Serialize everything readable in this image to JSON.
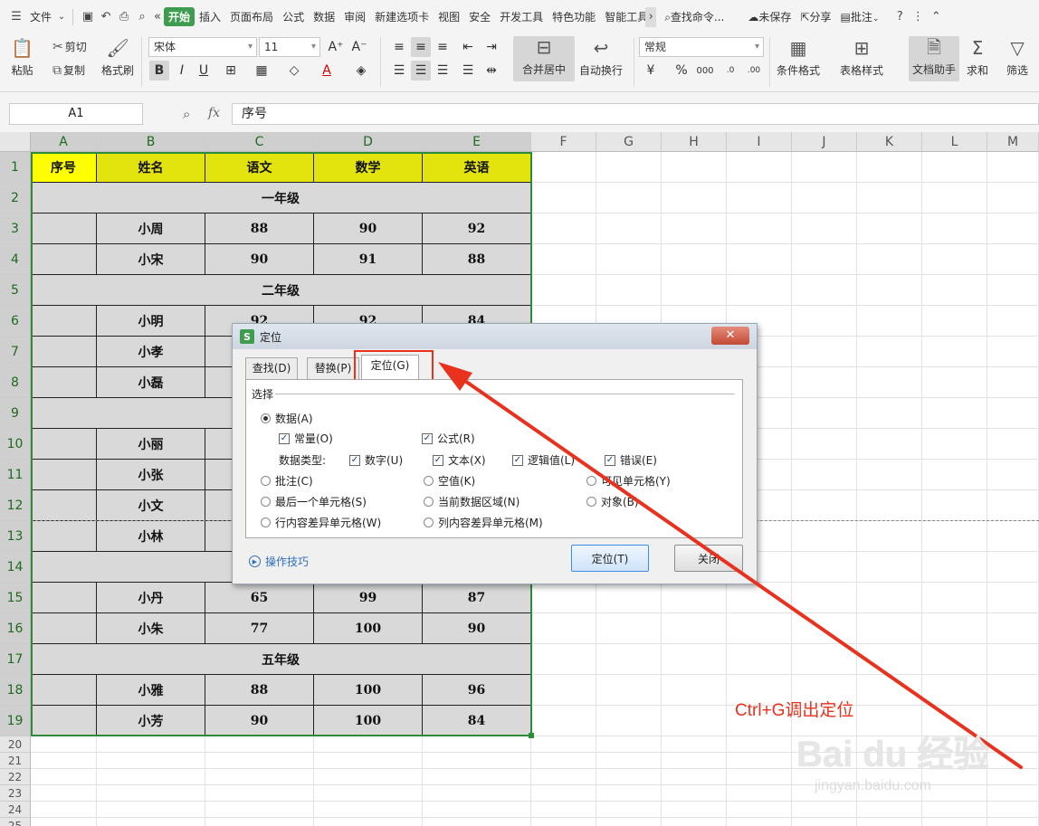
{
  "menubar": {
    "file": "文件",
    "tabs": [
      "开始",
      "插入",
      "页面布局",
      "公式",
      "数据",
      "审阅",
      "新建选项卡",
      "视图",
      "安全",
      "开发工具",
      "特色功能",
      "智能工具"
    ],
    "active_tab": "开始",
    "search": "查找命令...",
    "unsaved": "未保存",
    "share": "分享",
    "comment": "批注"
  },
  "ribbon": {
    "paste": "粘贴",
    "cut": "剪切",
    "copy": "复制",
    "format_painter": "格式刷",
    "font_name": "宋体",
    "font_size": "11",
    "merge_center": "合并居中",
    "wrap_text": "自动换行",
    "number_format": "常规",
    "conditional_format": "条件格式",
    "table_style": "表格样式",
    "doc_assistant": "文档助手",
    "sum": "求和",
    "filter": "筛选"
  },
  "formula_bar": {
    "cell_ref": "A1",
    "fx": "fx",
    "content": "序号"
  },
  "columns": [
    "A",
    "B",
    "C",
    "D",
    "E",
    "F",
    "G",
    "H",
    "I",
    "J",
    "K",
    "L",
    "M"
  ],
  "rows": [
    "1",
    "2",
    "3",
    "4",
    "5",
    "6",
    "7",
    "8",
    "9",
    "10",
    "11",
    "12",
    "13",
    "14",
    "15",
    "16",
    "17",
    "18",
    "19",
    "20",
    "21",
    "22",
    "23",
    "24",
    "25"
  ],
  "table": {
    "headers": [
      "序号",
      "姓名",
      "语文",
      "数学",
      "英语"
    ],
    "r2": "一年级",
    "r3": [
      "小周",
      "88",
      "90",
      "92"
    ],
    "r4": [
      "小宋",
      "90",
      "91",
      "88"
    ],
    "r5": "二年级",
    "r6": [
      "小明",
      "92",
      "92",
      "84"
    ],
    "r7": "小孝",
    "r8": "小磊",
    "r10": "小丽",
    "r11": "小张",
    "r12": "小文",
    "r13": "小林",
    "r15": [
      "小丹",
      "65",
      "99",
      "87"
    ],
    "r16": [
      "小朱",
      "77",
      "100",
      "90"
    ],
    "r17": "五年级",
    "r18": [
      "小雅",
      "88",
      "100",
      "96"
    ],
    "r19": [
      "小芳",
      "90",
      "100",
      "84"
    ]
  },
  "dialog": {
    "title": "定位",
    "tabs": [
      "查找(D)",
      "替换(P)",
      "定位(G)"
    ],
    "group": "选择",
    "data": "数据(A)",
    "constant": "常量(O)",
    "formula": "公式(R)",
    "data_type": "数据类型:",
    "number": "数字(U)",
    "text": "文本(X)",
    "logical": "逻辑值(L)",
    "error": "错误(E)",
    "comments": "批注(C)",
    "blanks": "空值(K)",
    "visible": "可见单元格(Y)",
    "last_cell": "最后一个单元格(S)",
    "current_region": "当前数据区域(N)",
    "objects": "对象(B)",
    "row_diff": "行内容差异单元格(W)",
    "col_diff": "列内容差异单元格(M)",
    "tips": "操作技巧",
    "locate_btn": "定位(T)",
    "close_btn": "关闭"
  },
  "annotation": {
    "text": "Ctrl+G调出定位",
    "color": "#e8321e"
  },
  "watermark": {
    "brand": "Bai du 经验",
    "url": "jingyan.baidu.com"
  },
  "colors": {
    "accent": "#3d9c4f",
    "header_fill": "#e3e30e",
    "body_fill": "#d9d9d9",
    "selection": "#2e8b3a"
  }
}
